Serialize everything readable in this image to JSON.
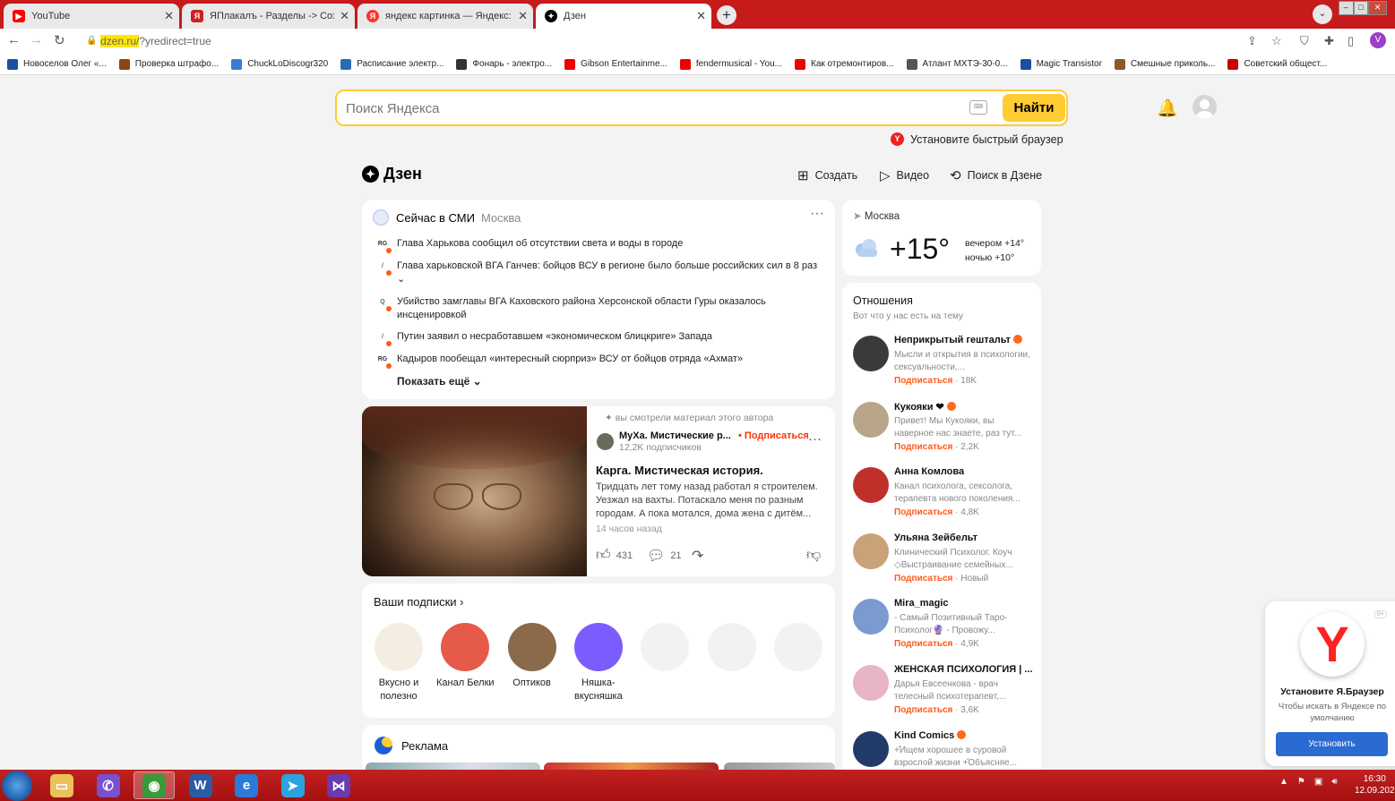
{
  "tabs": [
    {
      "title": "YouTube",
      "icon": "youtube-icon",
      "color": "#ff0000"
    },
    {
      "title": "ЯПлакалъ - Разделы -> Создан",
      "icon": "yaplakal-icon",
      "color": "#c22"
    },
    {
      "title": "яндекс картинка — Яндекс: наш",
      "icon": "yandex-icon",
      "color": "#f33"
    },
    {
      "title": "Дзен",
      "icon": "dzen-icon",
      "color": "#000"
    }
  ],
  "address": {
    "highlight": "dzen.ru/",
    "rest": "?yredirect=true"
  },
  "profile_letter": "V",
  "bookmarks": [
    {
      "label": "Новоселов Олег «...",
      "color": "#1a4fa0"
    },
    {
      "label": "Проверка штрафо...",
      "color": "#8b4513"
    },
    {
      "label": "ChuckLoDiscogr320",
      "color": "#3a7bd5"
    },
    {
      "label": "Расписание электр...",
      "color": "#2b6cb0"
    },
    {
      "label": "Фонарь - электро...",
      "color": "#333"
    },
    {
      "label": "Gibson Entertainme...",
      "color": "#e00"
    },
    {
      "label": "fendermusical - You...",
      "color": "#e00"
    },
    {
      "label": "Как отремонтиров...",
      "color": "#e00"
    },
    {
      "label": "Атлант МХТЭ-30-0...",
      "color": "#555"
    },
    {
      "label": "Magic Transistor",
      "color": "#1a4fa0"
    },
    {
      "label": "Смешные приколь...",
      "color": "#8b5a2b"
    },
    {
      "label": "Советский общест...",
      "color": "#c00"
    }
  ],
  "search": {
    "placeholder": "Поиск Яндекса",
    "button": "Найти"
  },
  "install_browser_link": "Установите быстрый браузер",
  "dzen": {
    "logo": "Дзен",
    "actions": {
      "create": "Создать",
      "video": "Видео",
      "search": "Поиск в Дзене"
    }
  },
  "news": {
    "title": "Сейчас в СМИ",
    "location": "Москва",
    "items": [
      {
        "text": "Глава Харькова сообщил об отсутствии света и воды в городе",
        "src": "RG"
      },
      {
        "text": "Глава харьковской ВГА Ганчев: бойцов ВСУ в регионе было больше российских сил в 8 раз ⌄",
        "src": "/"
      },
      {
        "text": "Убийство замглавы ВГА Каховского района Херсонской области Гуры оказалось инсценировкой",
        "src": "Q"
      },
      {
        "text": "Путин заявил о несработавшем «экономическом блицкриге» Запада",
        "src": "/"
      },
      {
        "text": "Кадыров пообещал «интересный сюрприз» ВСУ от бойцов отряда «Ахмат»",
        "src": "RG"
      }
    ],
    "show_more": "Показать ещё"
  },
  "weather": {
    "city": "Москва",
    "temp": "+15°",
    "evening": "вечером +14°",
    "night": "ночью +10°"
  },
  "article": {
    "seen_note": "вы смотрели материал этого автора",
    "channel": "⁣МуХа. Мистические р...",
    "subscribe": "Подписаться",
    "subscribers": "12,2K подписчиков",
    "title": "Карга. Мистическая история.",
    "text": "Тридцать лет тому назад работал я строителем. Уезжал на вахты. Потаскало меня по разным городам. А пока мотался, дома жена с дитём...",
    "time": "14 часов назад",
    "likes": "431",
    "comments": "21"
  },
  "subscriptions": {
    "title": "Ваши подписки",
    "items": [
      {
        "name": "Вкусно и полезно",
        "color": "#f4eee2"
      },
      {
        "name": "Канал Белки",
        "color": "#e65a4a"
      },
      {
        "name": "Оптиков",
        "color": "#8a6a4a"
      },
      {
        "name": "Няшка-вкусняшка",
        "color": "#7b5cff"
      },
      {
        "name": "",
        "color": "#f2f2f2"
      },
      {
        "name": "",
        "color": "#f2f2f2"
      },
      {
        "name": "",
        "color": "#f2f2f2"
      }
    ]
  },
  "ad": {
    "title": "Реклама"
  },
  "relations": {
    "title": "Отношения",
    "subtitle": "Вот что у нас есть на тему",
    "subscribe_label": "Подписаться",
    "items": [
      {
        "name": "Неприкрытый гештальт",
        "desc": "Мысли и открытия в психологии, сексуальности,...",
        "count": "18K",
        "verified": true,
        "color": "#3a3a3a"
      },
      {
        "name": "Кукояки ❤",
        "desc": "Привет! Мы Кукояки, вы наверное нас знаете, раз тут...",
        "count": "2,2K",
        "verified": true,
        "color": "#b8a58a"
      },
      {
        "name": "Анна Комлова",
        "desc": "Канал психолога, сексолога, терапевта нового поколения...",
        "count": "4,8K",
        "verified": false,
        "color": "#c0302a"
      },
      {
        "name": "Ульяна Зейбельт",
        "desc": "Клинический Психолог. Коуч ◇Выстраивание семейных...",
        "count": "Новый",
        "verified": false,
        "color": "#c9a27a"
      },
      {
        "name": "Mira_magic",
        "desc": "- Самый Позитивный Таро-Психолог🔮 - Провожу...",
        "count": "4,9K",
        "verified": false,
        "color": "#7a9ad0"
      },
      {
        "name": "ЖЕНСКАЯ ПСИХОЛОГИЯ | ...",
        "desc": "Дарья Евсеенкова - врач телесный психотерапевт,...",
        "count": "3,6K",
        "verified": false,
        "color": "#e8b4c8"
      },
      {
        "name": "Kind Comics",
        "desc": "+̊Ищем хорошее в суровой взрослой жизни +̊Объясняе...",
        "count": "",
        "verified": true,
        "color": "#223a6a"
      }
    ]
  },
  "yandex_popup": {
    "title": "Установите Я.Браузер",
    "desc": "Чтобы искать в Яндексе по умолчанию",
    "button": "Установить"
  },
  "taskbar": {
    "apps": [
      {
        "name": "explorer-app",
        "color": "#e9c25a",
        "glyph": "▭"
      },
      {
        "name": "viber-app",
        "color": "#7a4fd0",
        "glyph": "✆"
      },
      {
        "name": "chrome-app",
        "color": "#3a9a3a",
        "glyph": "◉"
      },
      {
        "name": "word-app",
        "color": "#2a5aa8",
        "glyph": "W"
      },
      {
        "name": "ie-app",
        "color": "#2a7ad8",
        "glyph": "e"
      },
      {
        "name": "telegram-app",
        "color": "#2aa3e0",
        "glyph": "➤"
      },
      {
        "name": "visualstudio-app",
        "color": "#6a3ab0",
        "glyph": "⋈"
      }
    ],
    "time": "16:30",
    "date": "12.09.202"
  }
}
